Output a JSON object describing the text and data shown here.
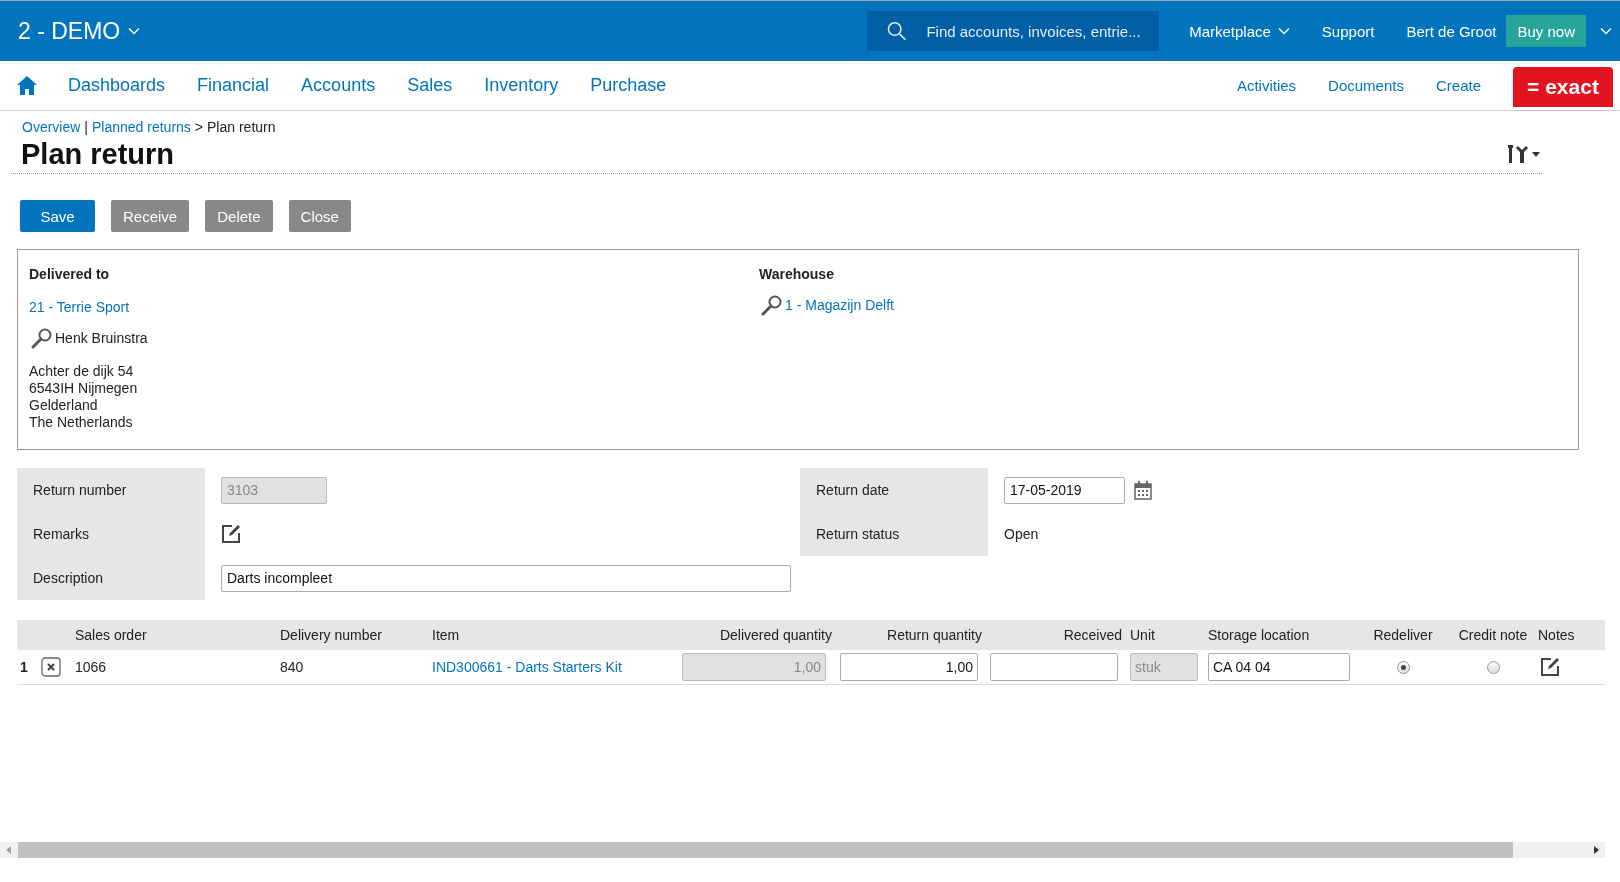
{
  "topbar": {
    "company": "2 - DEMO",
    "search": {
      "placeholder": "Find accounts, invoices, entrie..."
    },
    "links": [
      {
        "label": "Marketplace",
        "dropdown": true
      },
      {
        "label": "Support",
        "dropdown": false
      }
    ],
    "user": "Bert de Groot",
    "buy_button": "Buy now"
  },
  "nav": {
    "items": [
      "Dashboards",
      "Financial",
      "Accounts",
      "Sales",
      "Inventory",
      "Purchase"
    ],
    "right_items": [
      "Activities",
      "Documents",
      "Create"
    ],
    "logo": "= exact"
  },
  "breadcrumb": [
    {
      "kind": "link",
      "text": "Overview"
    },
    {
      "kind": "sep",
      "text": "|"
    },
    {
      "kind": "link",
      "text": "Planned returns"
    },
    {
      "kind": "sep",
      "text": ">"
    },
    {
      "kind": "current",
      "text": "Plan return"
    }
  ],
  "title": "Plan return",
  "buttons": [
    {
      "label": "Save",
      "primary": true
    },
    {
      "label": "Receive",
      "primary": false
    },
    {
      "label": "Delete",
      "primary": false
    },
    {
      "label": "Close",
      "primary": false
    }
  ],
  "delivered_to": {
    "heading": "Delivered to",
    "account": "21 - Terrie Sport",
    "contact": "Henk Bruinstra",
    "address": [
      "Achter de dijk 54",
      "6543IH Nijmegen",
      "Gelderland",
      "The Netherlands"
    ]
  },
  "warehouse": {
    "heading": "Warehouse",
    "value": "1 - Magazijn Delft"
  },
  "fields_left": [
    {
      "label": "Return number",
      "kind": "readonly",
      "value": "3103"
    },
    {
      "label": "Remarks",
      "kind": "note"
    },
    {
      "label": "Description",
      "kind": "input",
      "value": "Darts incompleet"
    }
  ],
  "fields_right": [
    {
      "label": "Return date",
      "kind": "date",
      "value": "17-05-2019"
    },
    {
      "label": "Return status",
      "kind": "text",
      "value": "Open"
    }
  ],
  "table": {
    "columns": [
      "Sales order",
      "Delivery number",
      "Item",
      "Delivered quantity",
      "Return quantity",
      "Received",
      "Unit",
      "Storage location",
      "Redeliver",
      "Credit note",
      "Notes"
    ],
    "rows": [
      {
        "number": "1",
        "sales_order": "1066",
        "delivery_number": "840",
        "item": "IND300661 - Darts Starters Kit",
        "delivered_quantity": "1,00",
        "return_quantity": "1,00",
        "unit": "stuk",
        "storage_location": "CA 04 04",
        "redeliver": true,
        "credit_note": false
      }
    ]
  }
}
